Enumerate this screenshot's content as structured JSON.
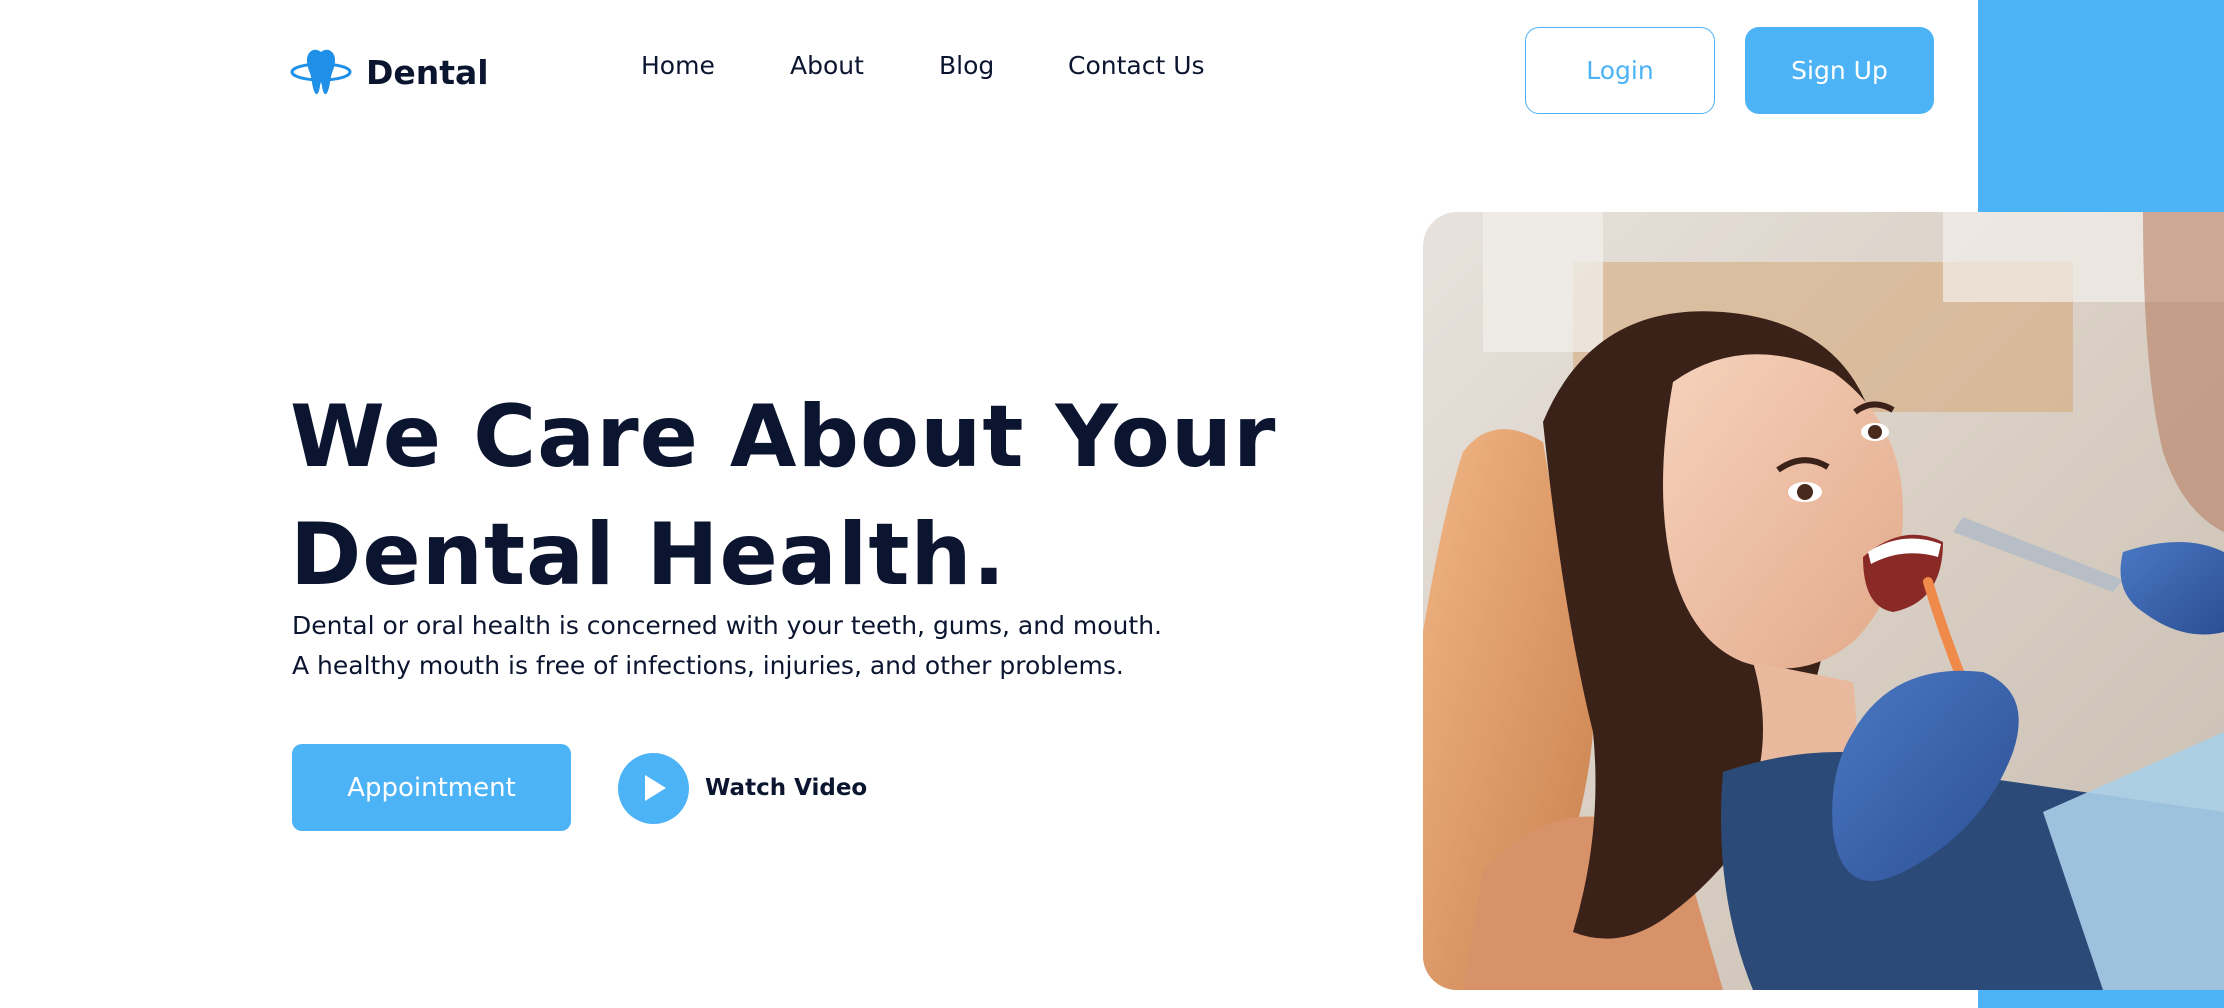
{
  "brand": {
    "name": "Dental",
    "logo_icon": "tooth-icon",
    "accent_color": "#4db3f7",
    "text_color": "#0b1530"
  },
  "nav": {
    "items": [
      {
        "label": "Home"
      },
      {
        "label": "About"
      },
      {
        "label": "Blog"
      },
      {
        "label": "Contact Us"
      }
    ]
  },
  "header": {
    "login_label": "Login",
    "signup_label": "Sign Up"
  },
  "hero": {
    "title_line1": "We Care About Your",
    "title_line2": "Dental Health.",
    "description_line1": "Dental or oral health is concerned with your teeth, gums, and mouth.",
    "description_line2": "A healthy mouth is free of infections, injuries, and other problems.",
    "appointment_label": "Appointment",
    "watch_video_label": "Watch Video",
    "play_icon": "play-icon",
    "image_subject": "patient-at-dentist-photo"
  }
}
